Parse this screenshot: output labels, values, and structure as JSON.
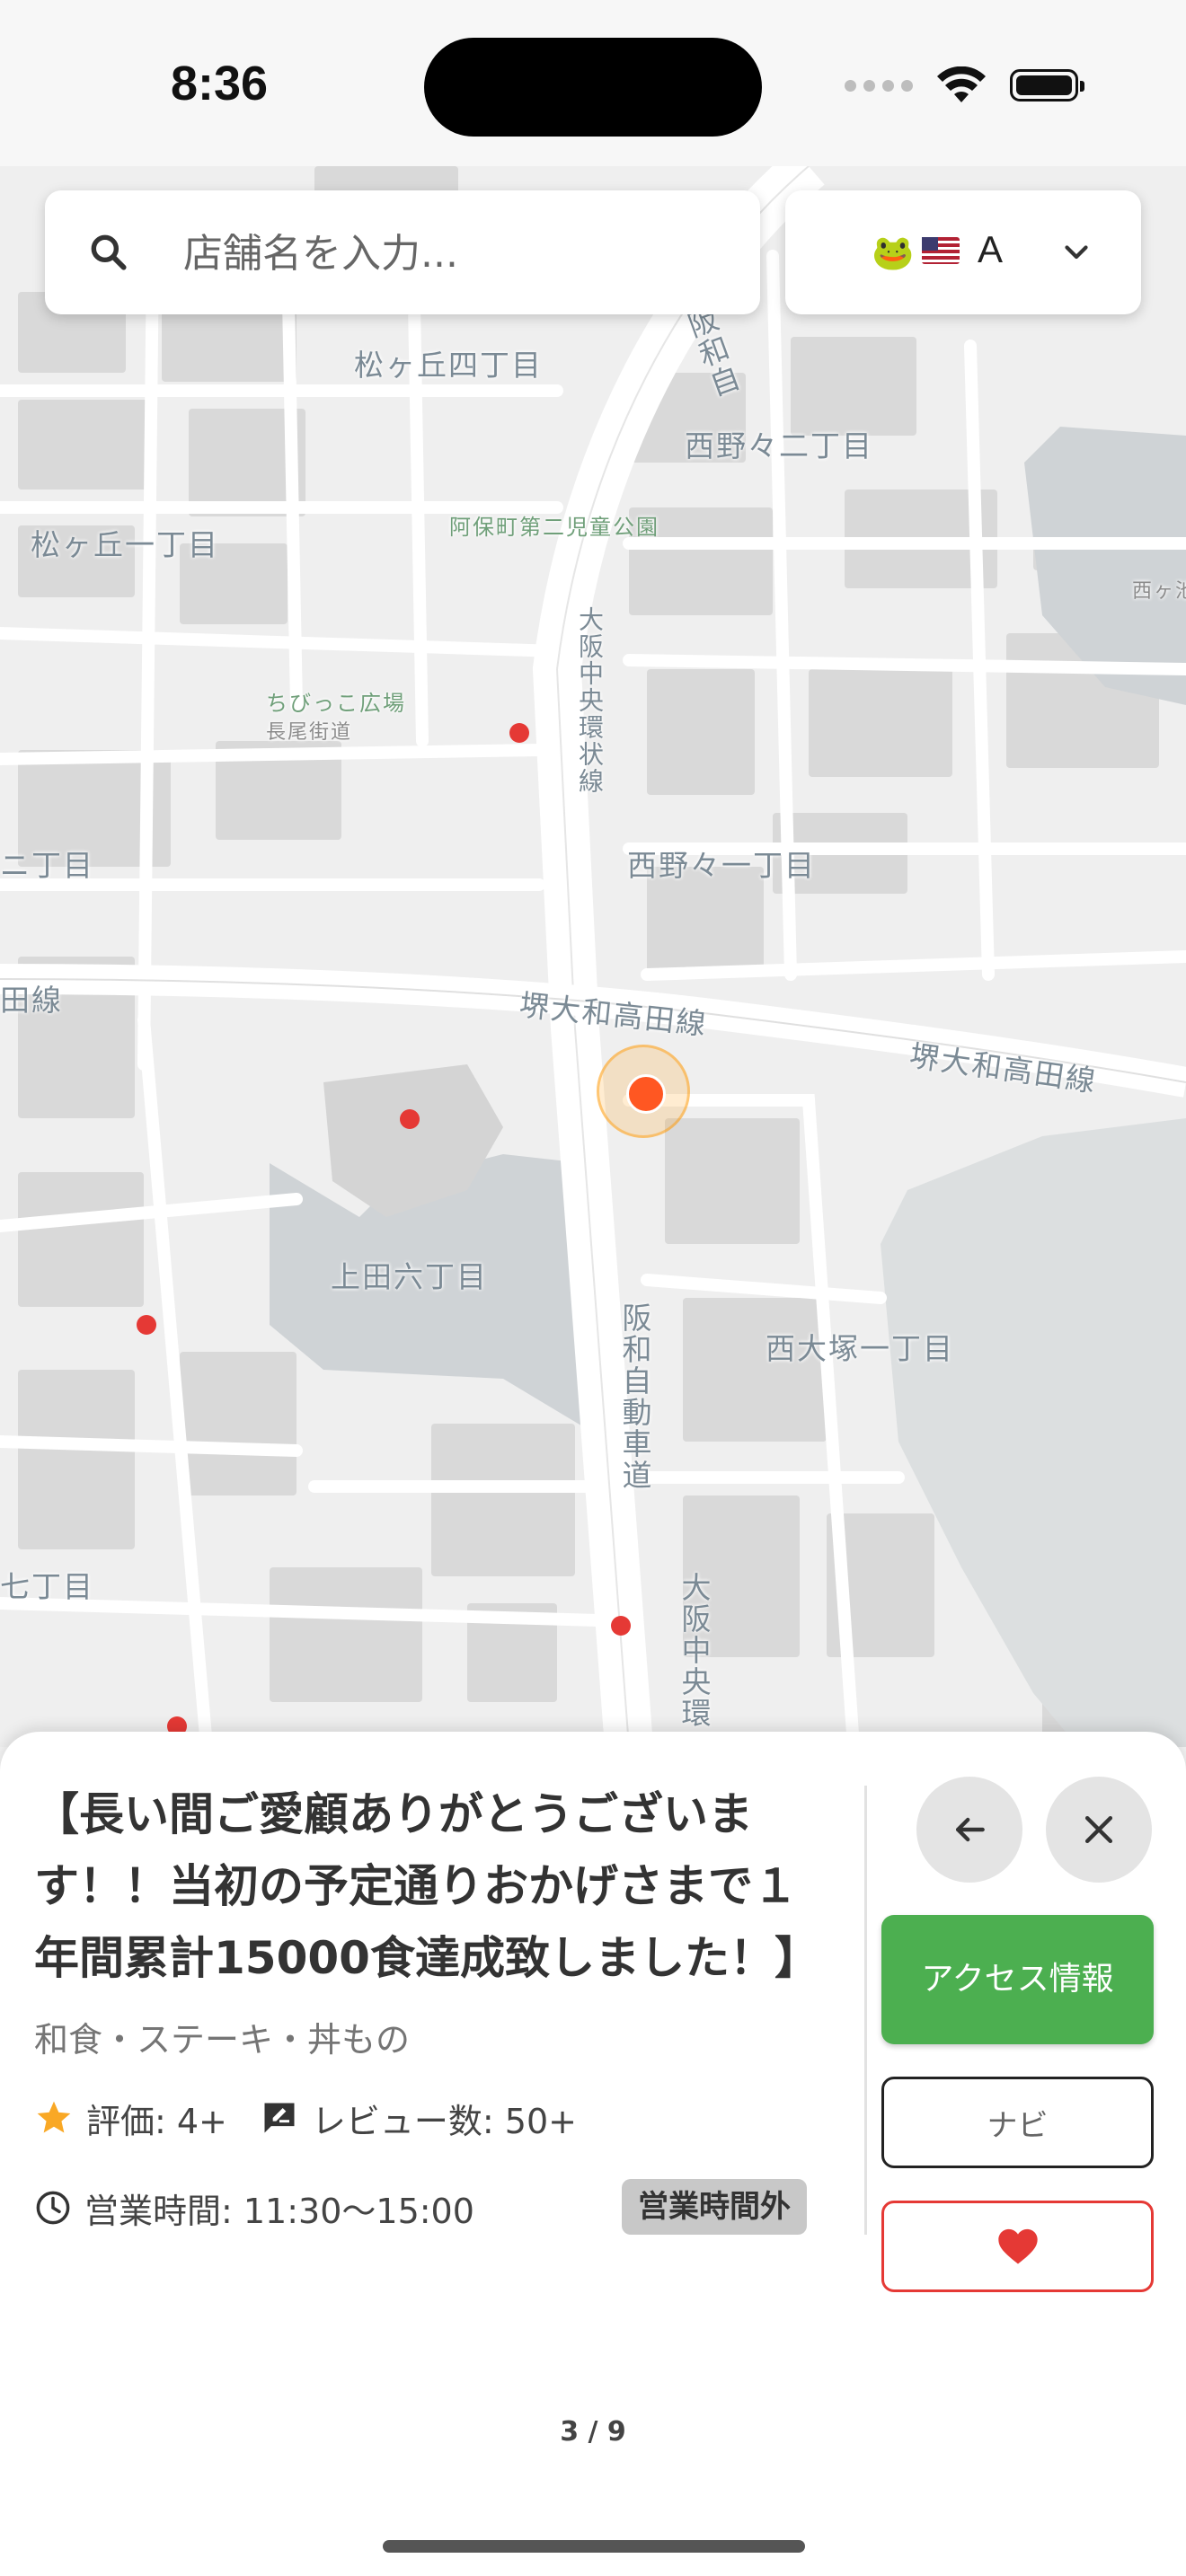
{
  "status_bar": {
    "time": "8:36"
  },
  "search": {
    "placeholder": "店舗名を入力..."
  },
  "language": {
    "selected": "A"
  },
  "map": {
    "labels": {
      "matsugaoka4": "松ヶ丘四丁目",
      "hanwa_top": "阪和自",
      "nishinono2": "西野々二丁目",
      "matsugaoka1": "松ヶ丘一丁目",
      "park": "阿保町第二児童公園",
      "nishigaike": "西ヶ池",
      "chuo_kanjo": "大阪中央環状線",
      "chibikko": "ちびっこ広場",
      "nagao": "長尾街道",
      "ni_chome": "ニ丁目",
      "nishinono1": "西野々一丁目",
      "sakai_yamato_left": "堺大和高田線",
      "sakai_yamato_right": "堺大和高田線",
      "ta_sen": "田線",
      "ueda6": "上田六丁目",
      "hanwa_express": "阪和自動車道",
      "nishiotsuka1": "西大塚一丁目",
      "nana_chome": "七丁目",
      "osaka_chuo_lower": "大阪中央環"
    }
  },
  "shop": {
    "title": "【長い間ご愛顧ありがとうございます！！当初の予定通りおかげさまで１年間累計15000食達成致しました！】",
    "genre": "和食・ステーキ・丼もの",
    "rating": "評価: 4+",
    "reviews": "レビュー数: 50+",
    "hours": "営業時間: 11:30〜15:00",
    "status": "営業時間外"
  },
  "actions": {
    "access": "アクセス情報",
    "navi": "ナビ"
  },
  "pager": "3 / 9",
  "colors": {
    "accent_green": "#4caf50",
    "marker_red": "#e53935",
    "current_location": "#ff5722",
    "star": "#f9a825"
  },
  "icons": [
    "search-icon",
    "frog-icon",
    "us-flag-icon",
    "chevron-down-icon",
    "back-arrow-icon",
    "close-icon",
    "star-icon",
    "review-icon",
    "clock-icon",
    "heart-icon"
  ]
}
